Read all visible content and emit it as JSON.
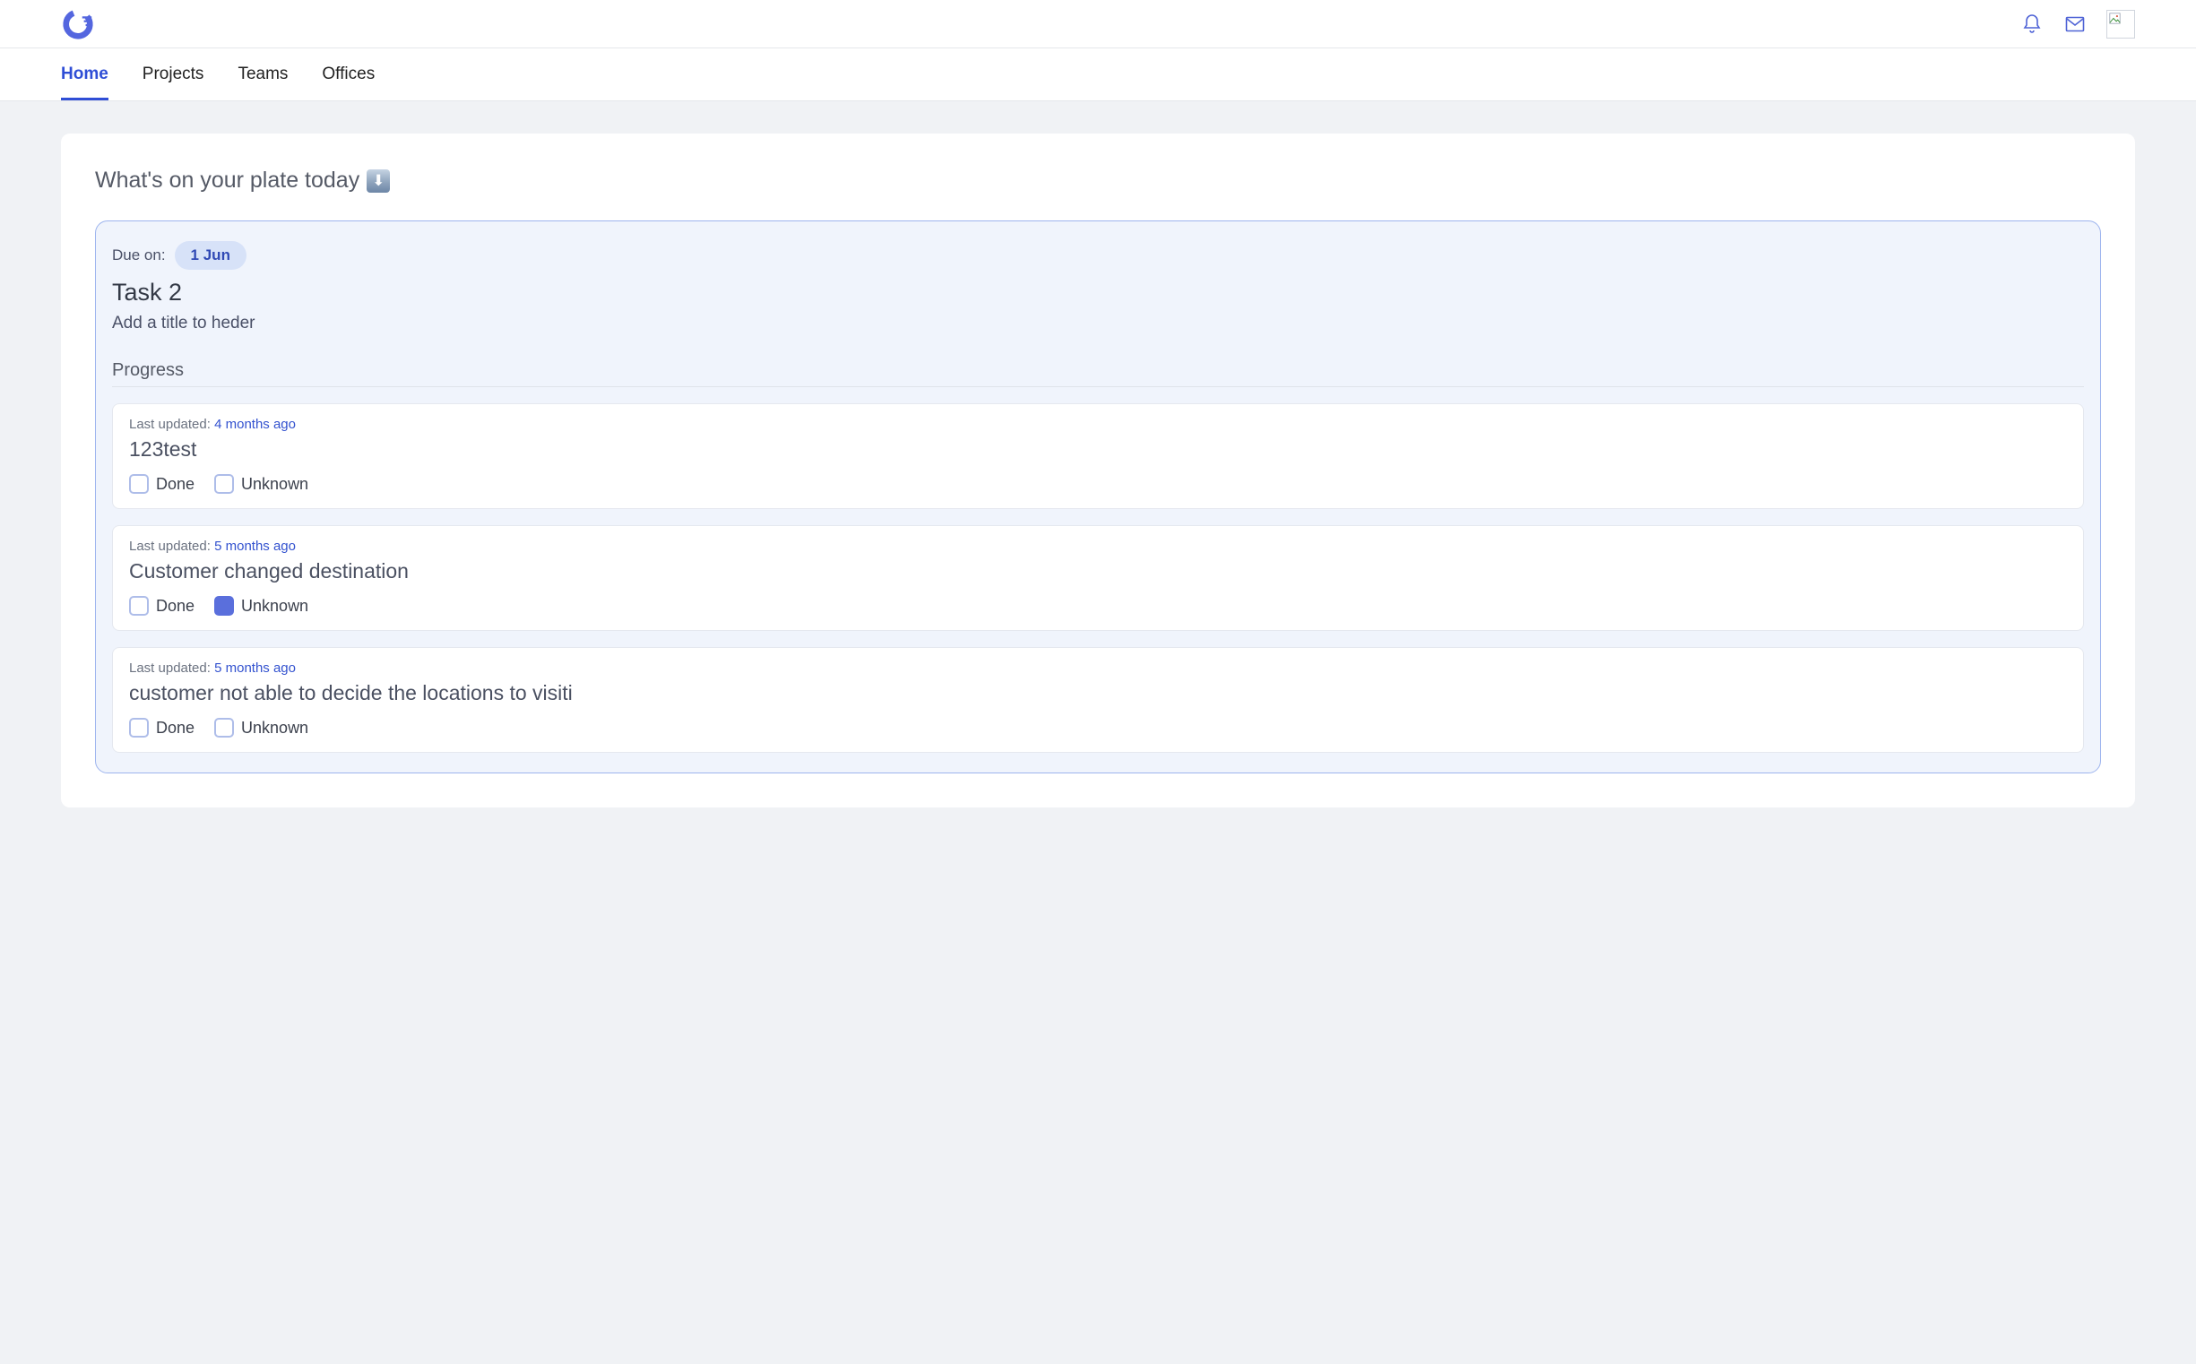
{
  "nav": {
    "items": [
      {
        "label": "Home",
        "active": true
      },
      {
        "label": "Projects",
        "active": false
      },
      {
        "label": "Teams",
        "active": false
      },
      {
        "label": "Offices",
        "active": false
      }
    ]
  },
  "heading": {
    "text": "What's on your plate today",
    "arrow_glyph": "⬇"
  },
  "task": {
    "due_label": "Due on:",
    "due_value": "1 Jun",
    "title": "Task 2",
    "description": "Add a title to heder",
    "progress_label": "Progress"
  },
  "last_updated_label": "Last updated:",
  "option_labels": {
    "done": "Done",
    "unknown": "Unknown"
  },
  "progress_items": [
    {
      "updated": "4 months ago",
      "title": "123test",
      "done": false,
      "unknown": false
    },
    {
      "updated": "5 months ago",
      "title": "Customer changed destination",
      "done": false,
      "unknown": true
    },
    {
      "updated": "5 months ago",
      "title": "customer not able to decide the locations to visiti",
      "done": false,
      "unknown": false
    }
  ]
}
